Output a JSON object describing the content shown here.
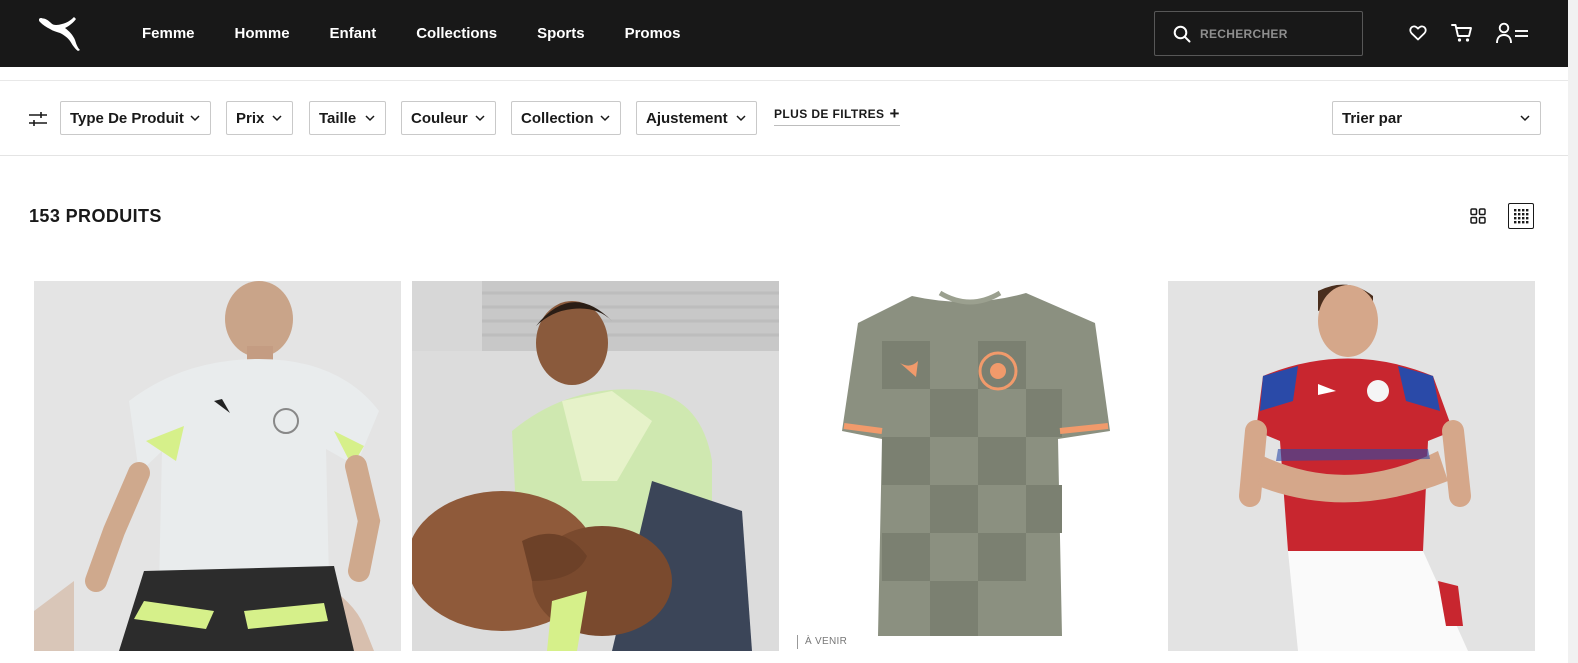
{
  "nav": {
    "links": [
      "Femme",
      "Homme",
      "Enfant",
      "Collections",
      "Sports",
      "Promos"
    ],
    "search_placeholder": "RECHERCHER"
  },
  "filters": {
    "items": [
      "Type De Produit",
      "Prix",
      "Taille",
      "Couleur",
      "Collection",
      "Ajustement"
    ],
    "more_label": "PLUS DE FILTRES",
    "sort_label": "Trier par"
  },
  "listing": {
    "count_label": "153 PRODUITS",
    "badge_coming": "À VENIR"
  },
  "colors": {
    "nav_bg": "#181818",
    "accent_lime": "#d6f08a",
    "shakhtar_orange": "#f19a6b",
    "czech_red": "#c8262f",
    "czech_blue": "#2a4aa8"
  }
}
